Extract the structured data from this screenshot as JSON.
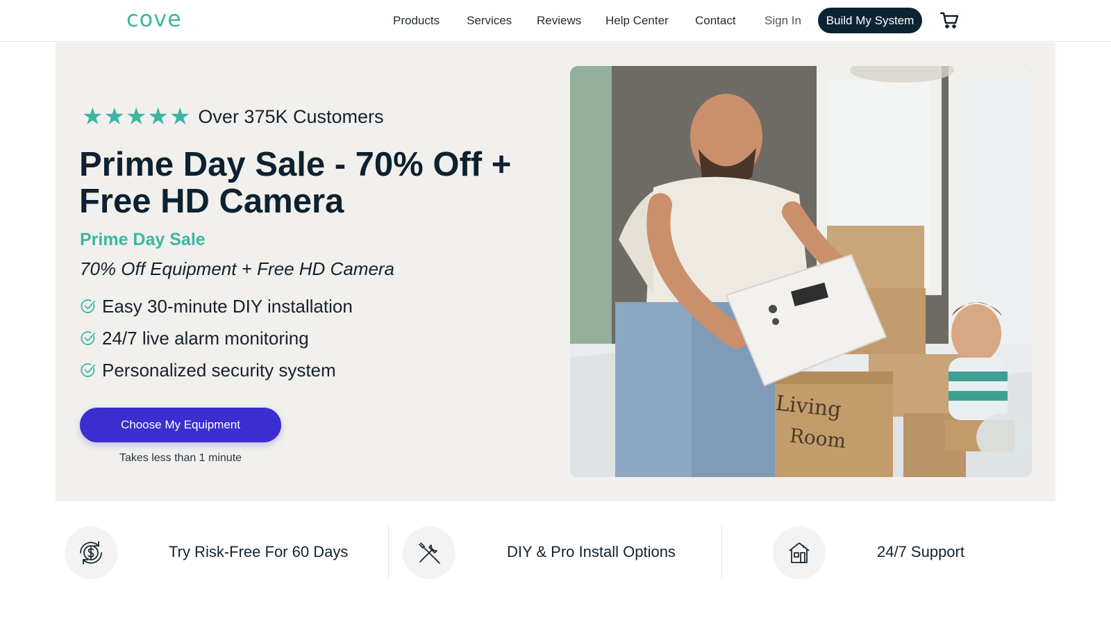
{
  "header": {
    "logo": "cove",
    "nav": [
      "Products",
      "Services",
      "Reviews",
      "Help Center",
      "Contact"
    ],
    "sign_in": "Sign In",
    "build_button": "Build My System",
    "cart_icon": "cart-icon"
  },
  "hero": {
    "stars": [
      "★",
      "★",
      "★",
      "★",
      "★"
    ],
    "rating_text": "Over 375K Customers",
    "headline": "Prime Day Sale - 70% Off + Free HD Camera",
    "subhead": "Prime Day Sale",
    "offer": "70% Off Equipment + Free HD Camera",
    "features": [
      "Easy 30-minute DIY installation",
      "24/7 live alarm monitoring",
      "Personalized security system"
    ],
    "cta": "Choose My Equipment",
    "cta_note": "Takes less than 1 minute"
  },
  "benefits": [
    {
      "label": "Try Risk-Free For 60 Days",
      "icon": "money-back-icon"
    },
    {
      "label": "DIY & Pro Install Options",
      "icon": "tools-icon"
    },
    {
      "label": "24/7 Support",
      "icon": "house-icon"
    }
  ],
  "colors": {
    "brand_teal": "#3cb6a3",
    "navy": "#0b2433",
    "cta_purple": "#3a2ed1",
    "hero_bg": "#f1f0ed"
  }
}
